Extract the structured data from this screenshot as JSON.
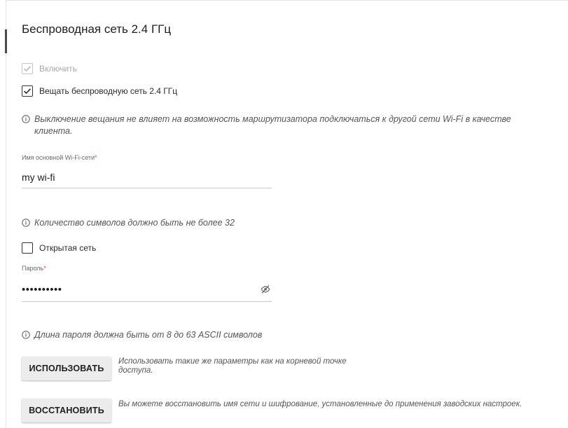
{
  "section": {
    "title": "Беспроводная сеть 2.4 ГГц"
  },
  "enable": {
    "label": "Включить",
    "checked": true,
    "disabled": true
  },
  "broadcast": {
    "label": "Вещать беспроводную сеть 2.4 ГГц",
    "checked": true
  },
  "broadcast_info": {
    "text": "Выключение вещания не влияет на возможность маршрутизатора подключаться к другой сети Wi-Fi в качестве клиента."
  },
  "ssid": {
    "label": "Имя основной Wi-Fi-сети",
    "required_mark": "*",
    "value": "my wi-fi",
    "hint": "Количество символов должно быть не более 32"
  },
  "open_network": {
    "label": "Открытая сеть",
    "checked": false
  },
  "password": {
    "label": "Пароль",
    "required_mark": "*",
    "value": "••••••••••",
    "toggle_icon": "eye-slash-icon",
    "hint": "Длина пароля должна быть от 8 до 63 ASCII символов"
  },
  "use_button": {
    "label": "ИСПОЛЬЗОВАТЬ",
    "description": "Использовать такие же параметры как на корневой точке доступа."
  },
  "restore_button": {
    "label": "ВОССТАНОВИТЬ",
    "description": "Вы можете восстановить имя сети и шифрование, установленные до применения заводских настроек."
  },
  "colors": {
    "required": "#e0403a",
    "button_bg": "#ececec",
    "text": "#202020",
    "hint_text": "#555555"
  }
}
